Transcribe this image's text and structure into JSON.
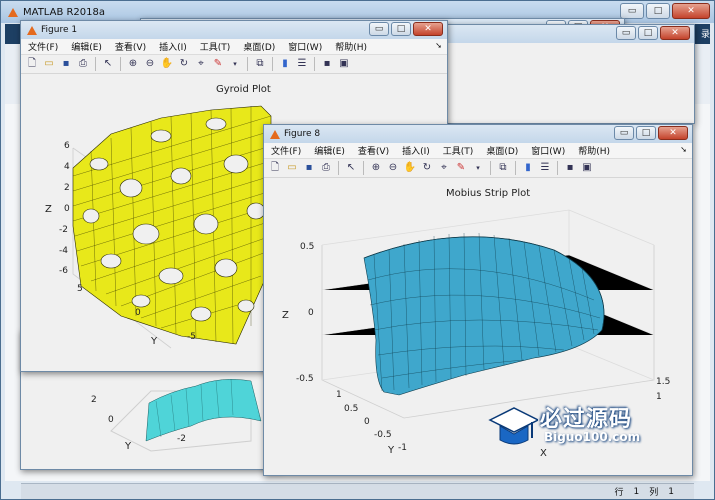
{
  "app": {
    "title": "MATLAB R2018a",
    "window_buttons": {
      "minimize": "▭",
      "maximize": "□",
      "close": "✕"
    },
    "side_fragment": "录",
    "statusbar": {
      "row_label": "行",
      "row_value": "1",
      "col_label": "列",
      "col_value": "1"
    }
  },
  "figure1": {
    "title": "Figure 1",
    "plot_title": "Gyroid Plot",
    "surface_color": "#e8e81a",
    "zlabel": "Z",
    "ylabel": "Y",
    "z_ticks": [
      "6",
      "4",
      "2",
      "0",
      "-2",
      "-4",
      "-6"
    ],
    "y_ticks": [
      "5",
      "0",
      "-5"
    ]
  },
  "figure_hidden": {
    "surface_color": "#4fd4d8",
    "ylabel": "Y",
    "y_ticks": [
      "2",
      "0",
      "-2"
    ]
  },
  "figure8": {
    "title": "Figure 8",
    "plot_title": "Mobius Strip Plot",
    "surface_color": "#3fa7cc",
    "zlabel": "Z",
    "ylabel": "Y",
    "xlabel": "X",
    "z_ticks": [
      "0.5",
      "0",
      "-0.5"
    ],
    "y_ticks": [
      "1",
      "0.5",
      "0",
      "-0.5",
      "-1"
    ],
    "x_ticks": [
      "1.5",
      "1"
    ]
  },
  "menus": [
    "文件(F)",
    "编辑(E)",
    "查看(V)",
    "插入(I)",
    "工具(T)",
    "桌面(D)",
    "窗口(W)",
    "帮助(H)"
  ],
  "toolbar_icons": [
    "new-figure-icon",
    "open-file-icon",
    "save-icon",
    "print-icon",
    "select-arrow-icon",
    "zoom-in-icon",
    "zoom-out-icon",
    "pan-hand-icon",
    "rotate-3d-icon",
    "data-cursor-icon",
    "brush-icon",
    "link-plot-icon",
    "colorbar-icon",
    "legend-icon",
    "hide-plot-tools-icon",
    "show-plot-tools-icon"
  ],
  "watermark": {
    "cn": "必过源码",
    "en": "Biguo100.com"
  }
}
